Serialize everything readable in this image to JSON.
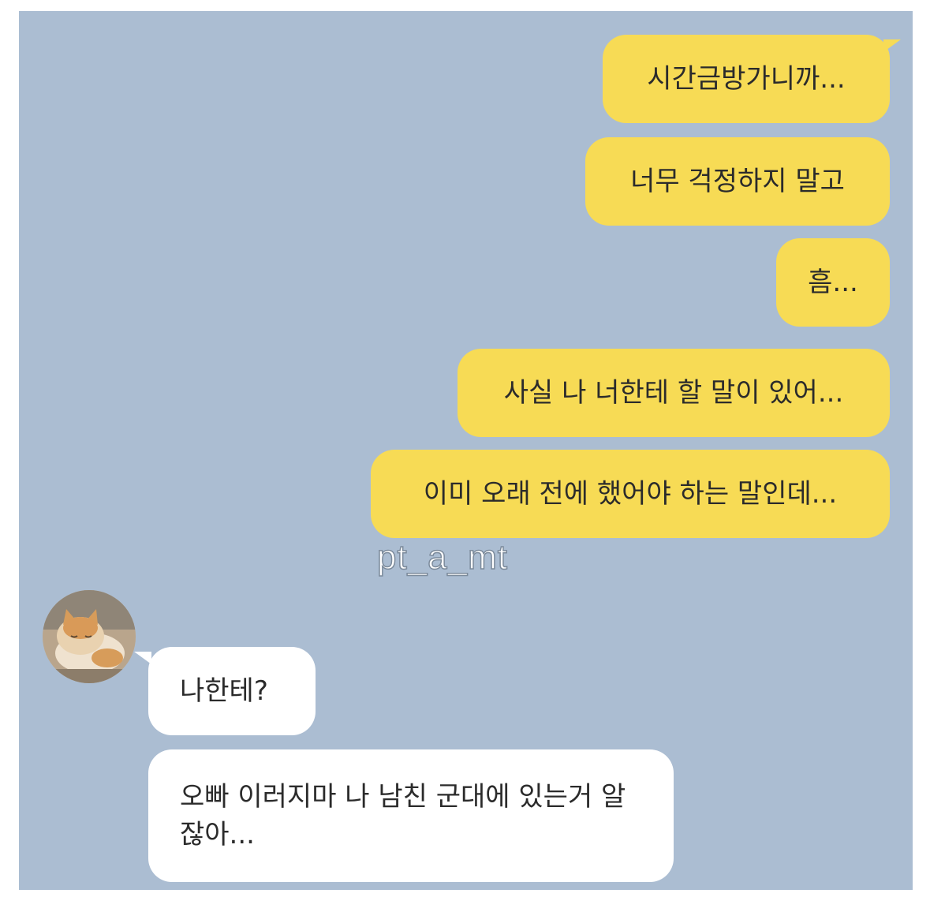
{
  "watermark": "pt_a_mt",
  "messages_sent": [
    "시간금방가니까...",
    "너무 걱정하지 말고",
    "흠...",
    "사실 나 너한테 할 말이 있어...",
    "이미 오래 전에 했어야 하는 말인데..."
  ],
  "messages_received": [
    "나한테?",
    "오빠 이러지마 나 남친 군대에 있는거 알잖아..."
  ],
  "colors": {
    "chat_background": "#abbdd2",
    "sent_bubble": "#f7db55",
    "received_bubble": "#ffffff"
  }
}
